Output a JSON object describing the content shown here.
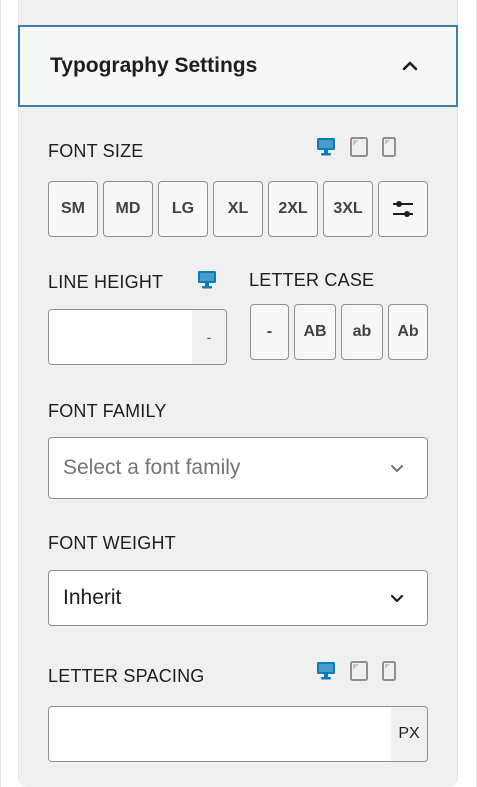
{
  "panel": {
    "title": "Typography Settings"
  },
  "font_size": {
    "label": "FONT SIZE",
    "buttons": [
      "SM",
      "MD",
      "LG",
      "XL",
      "2XL",
      "3XL"
    ]
  },
  "line_height": {
    "label": "LINE HEIGHT",
    "value": "",
    "unit": "-"
  },
  "letter_case": {
    "label": "LETTER CASE",
    "buttons": [
      "-",
      "AB",
      "ab",
      "Ab"
    ]
  },
  "font_family": {
    "label": "FONT FAMILY",
    "placeholder": "Select a font family"
  },
  "font_weight": {
    "label": "FONT WEIGHT",
    "value": "Inherit"
  },
  "letter_spacing": {
    "label": "LETTER SPACING",
    "value": "",
    "unit": "PX"
  },
  "colors": {
    "accent": "#0a7bbd",
    "header_border": "#3d7fb5",
    "panel_bg": "#f0f0f1"
  },
  "icons": [
    "chevron-up-icon",
    "desktop-icon",
    "tablet-icon",
    "mobile-icon",
    "sliders-icon",
    "chevron-down-icon"
  ]
}
